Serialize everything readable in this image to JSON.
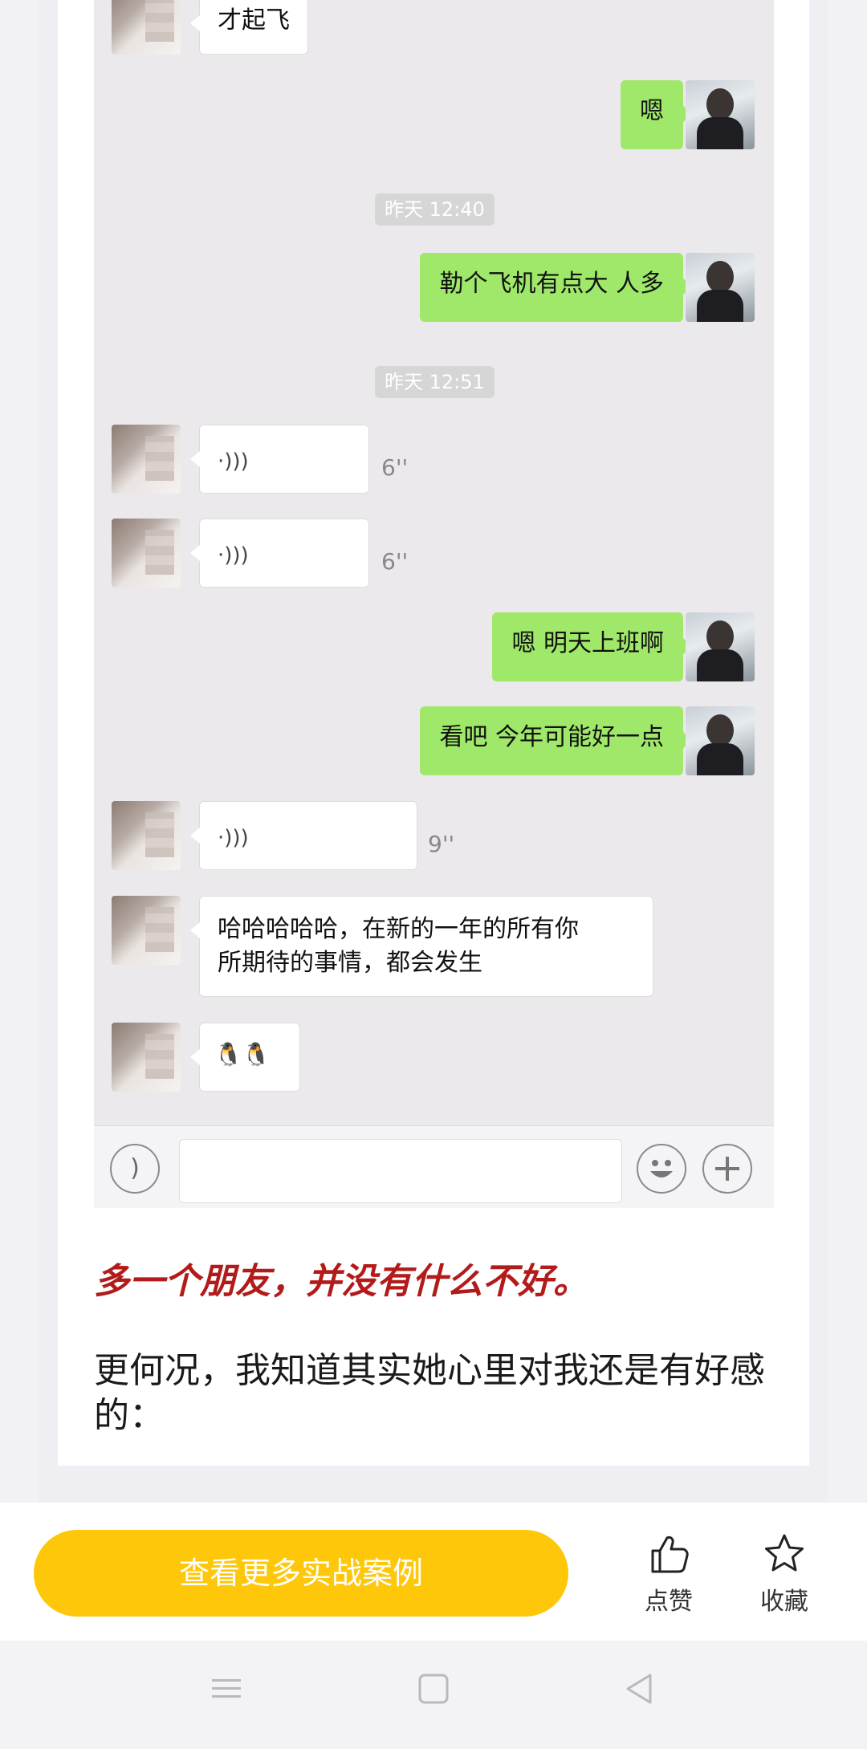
{
  "chat": {
    "messages": {
      "m1": "才起飞",
      "m2": "嗯",
      "ts1": "昨天 12:40",
      "m3": "勒个飞机有点大 人多",
      "ts2": "昨天 12:51",
      "v1": "6''",
      "v2": "6''",
      "m4": "嗯 明天上班啊",
      "m5": "看吧 今年可能好一点",
      "v3": "9''",
      "m6_line1": "哈哈哈哈哈，在新的一年的所有你",
      "m6_line2": "所期待的事情，都会发生",
      "m7": "🐧🐧"
    },
    "voice_icon": "·)))"
  },
  "article": {
    "highlight": "多一个朋友，并没有什么不好。",
    "body": "更何况，我知道其实她心里对我还是有好感的："
  },
  "actions": {
    "cta": "查看更多实战案例",
    "like": "点赞",
    "favorite": "收藏"
  },
  "colors": {
    "cta": "#fec70a",
    "highlight": "#b31b1b",
    "bubble_right": "#9fe86a"
  }
}
